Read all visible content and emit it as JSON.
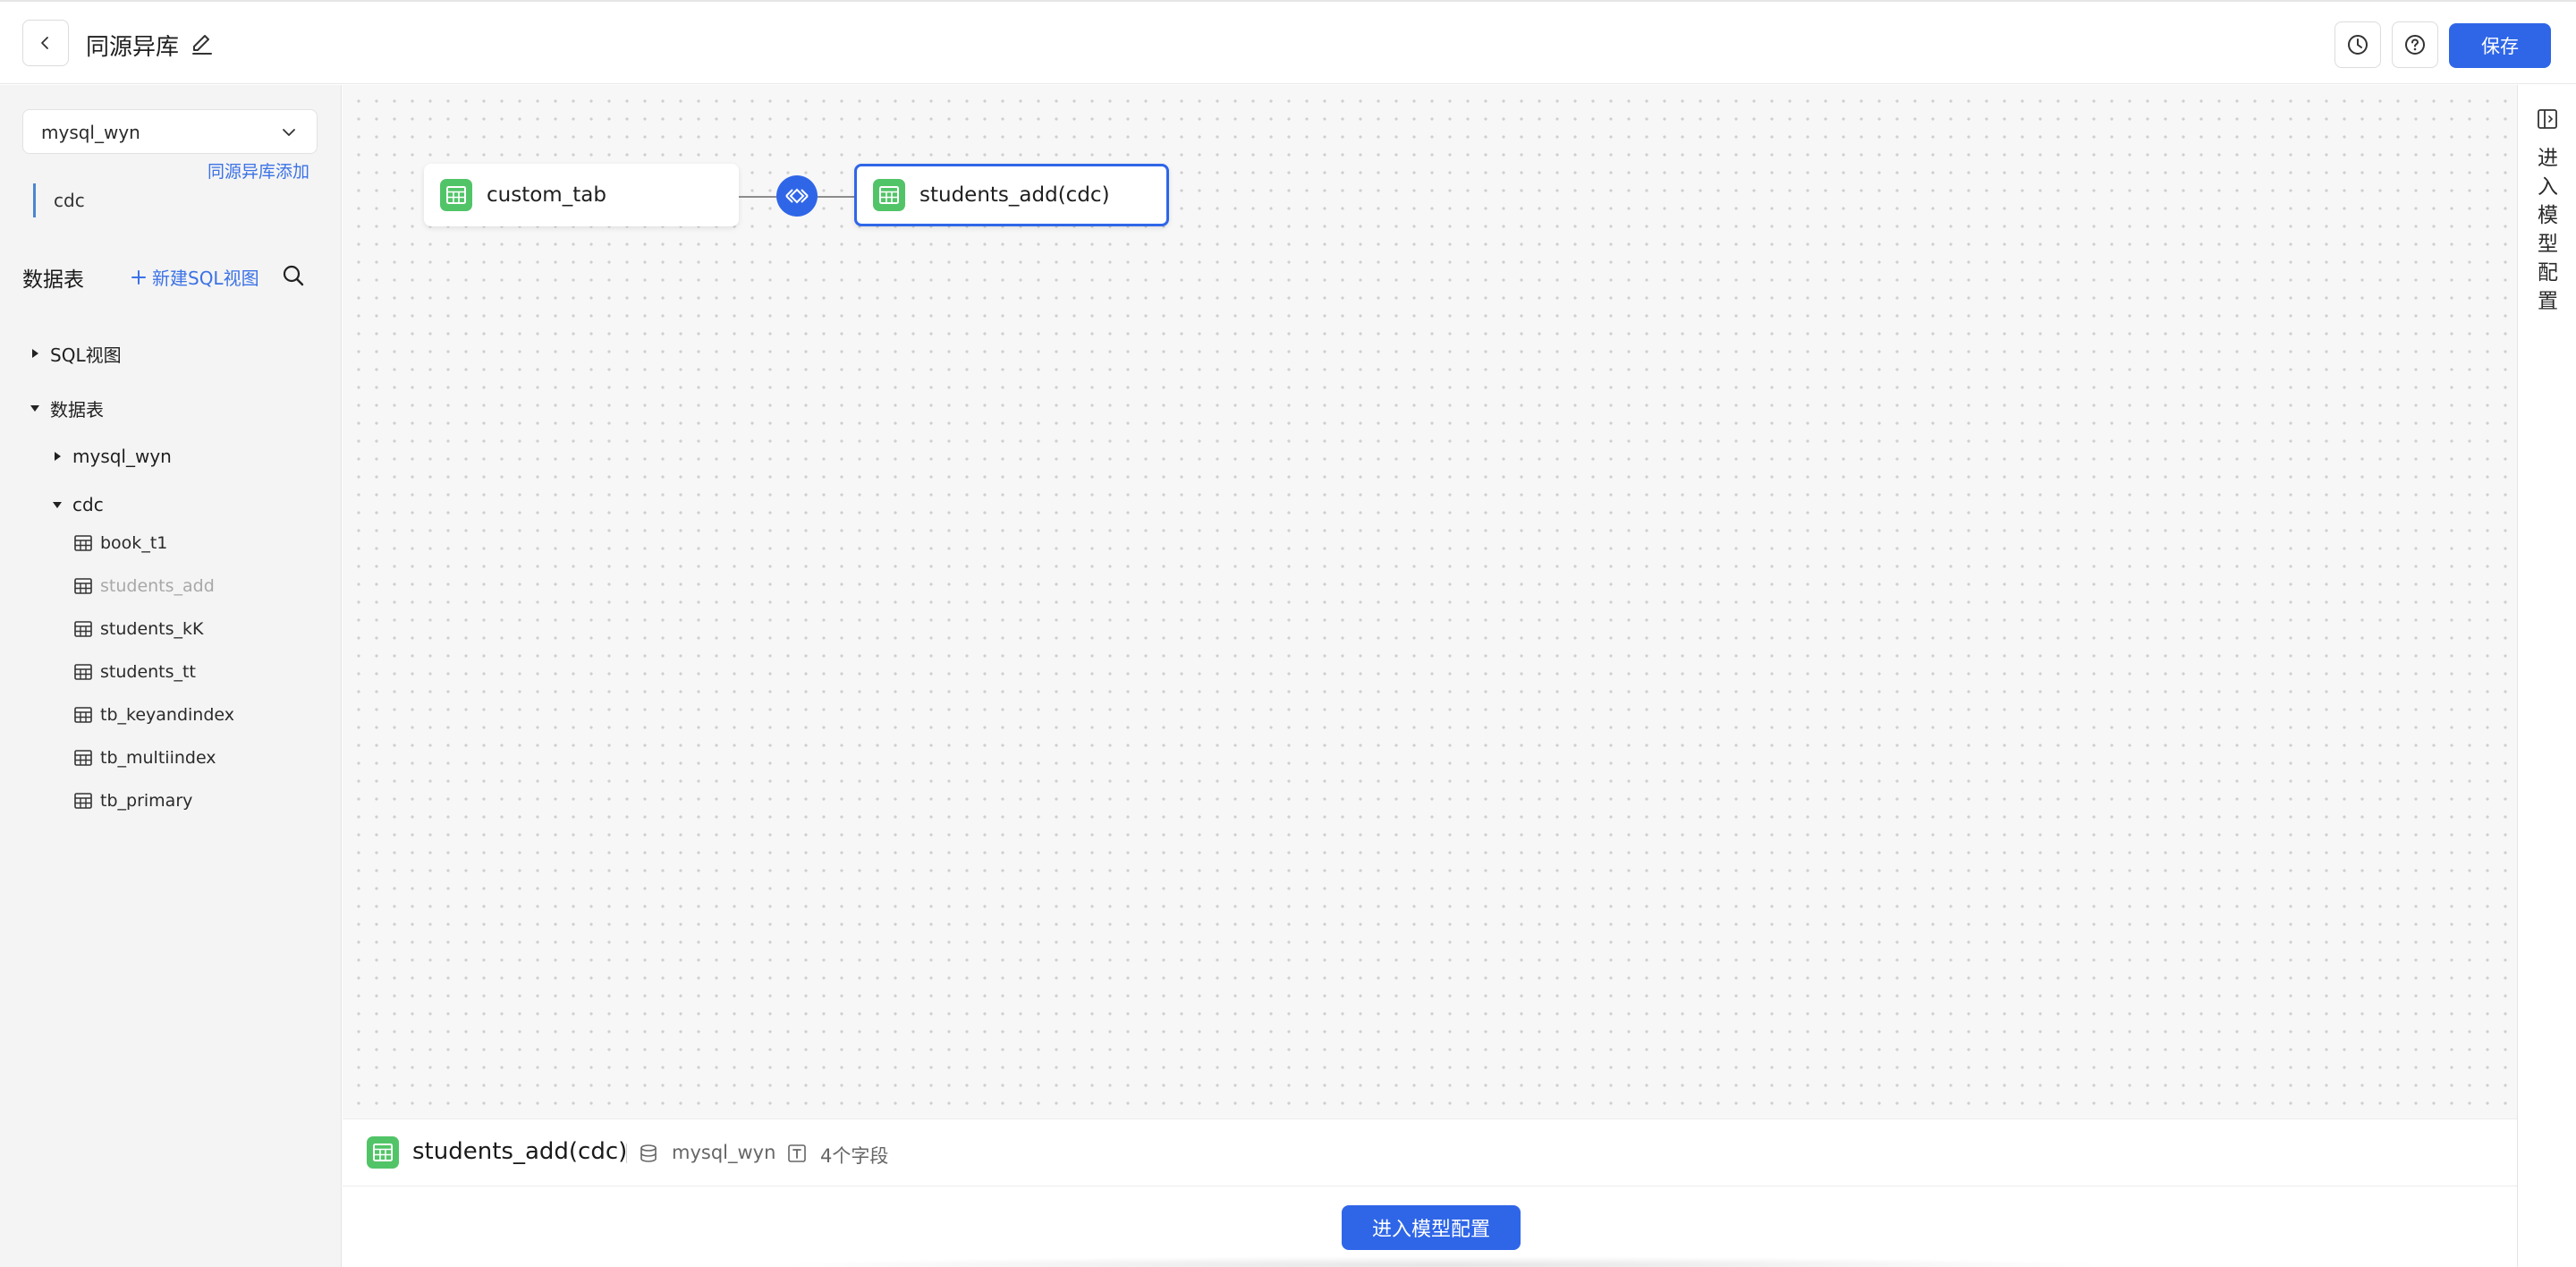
{
  "header": {
    "title": "同源异库",
    "save_label": "保存"
  },
  "sidebar": {
    "db_select": "mysql_wyn",
    "add_link": "同源异库添加",
    "db_chip": "cdc",
    "section_title": "数据表",
    "new_sql_view": "新建SQL视图",
    "tree": {
      "sql_view": "SQL视图",
      "data_tables": "数据表",
      "db1": "mysql_wyn",
      "db2": "cdc",
      "tables": [
        "book_t1",
        "students_add",
        "students_kK",
        "students_tt",
        "tb_keyandindex",
        "tb_multiindex",
        "tb_primary"
      ]
    }
  },
  "canvas": {
    "left_node": "custom_tab",
    "right_node": "students_add(cdc)"
  },
  "info_bar": {
    "title": "students_add(cdc)",
    "db": "mysql_wyn",
    "fields": "4个字段"
  },
  "footer": {
    "enter_button": "进入模型配置"
  },
  "right_panel": {
    "label": "进入模型配置"
  },
  "colors": {
    "primary": "#2f66e8",
    "table_icon_green": "#52c468"
  }
}
